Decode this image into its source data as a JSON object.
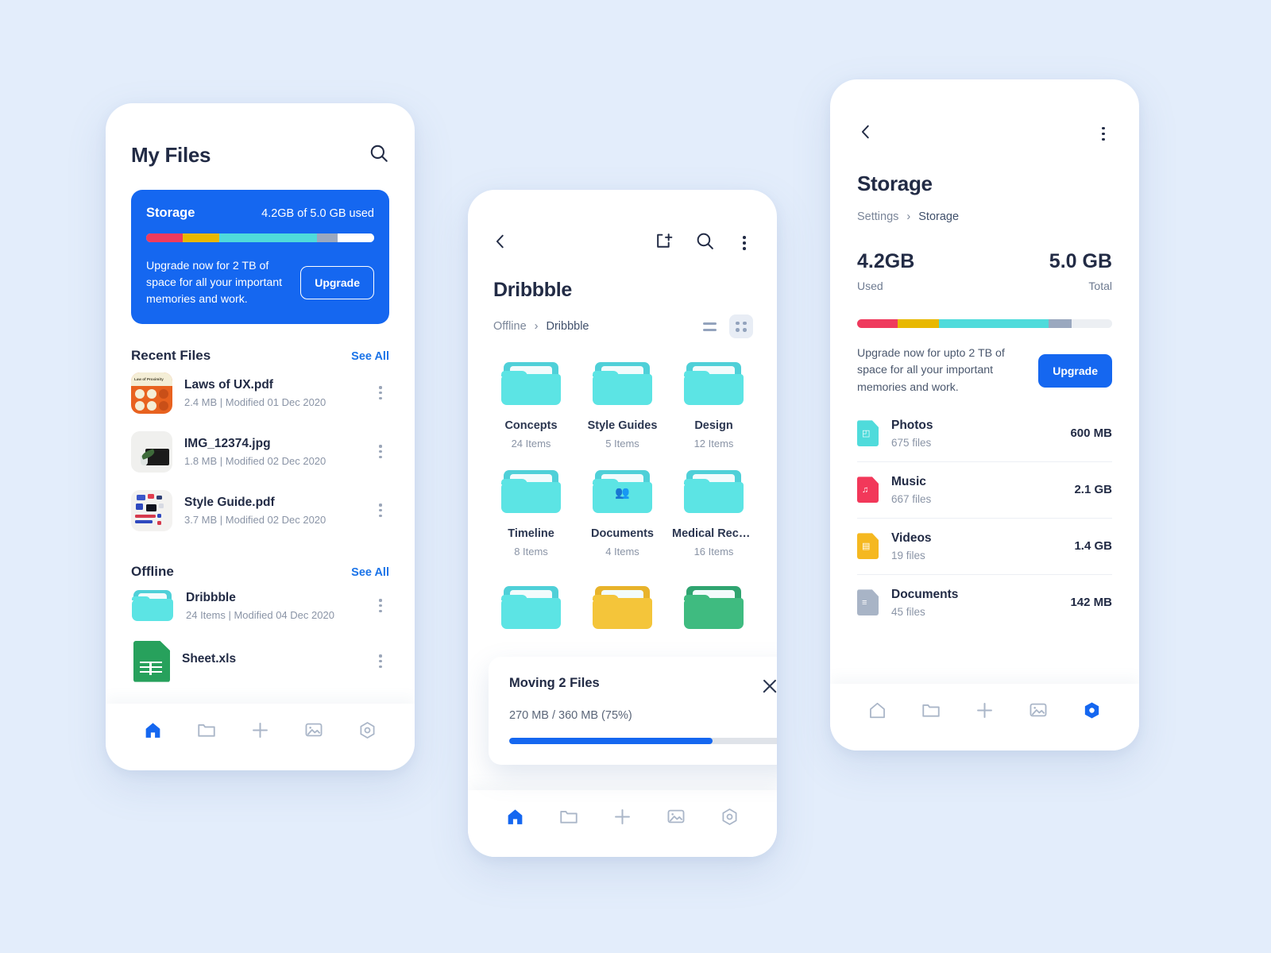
{
  "colors": {
    "background": "#e3edfb",
    "primary_blue": "#1567f0",
    "accent_teal": "#5ce4e4",
    "bar_red": "#ef3a5d",
    "bar_yellow": "#e8b800",
    "bar_cyan": "#4fdbdb",
    "bar_slate": "#9aa8bf",
    "text_dark": "#222b45",
    "text_mute": "#8a94a6"
  },
  "phone1": {
    "title": "My Files",
    "search_icon": "search-icon",
    "storage_card": {
      "label": "Storage",
      "usage": "4.2GB of 5.0 GB used",
      "promo": "Upgrade now for 2 TB of space for all your important memories and work.",
      "button": "Upgrade",
      "segments": [
        {
          "name": "photos",
          "color": "#ef3a5d",
          "percent": 16
        },
        {
          "name": "music",
          "color": "#e8b800",
          "percent": 16
        },
        {
          "name": "videos",
          "color": "#4fdbdb",
          "percent": 43
        },
        {
          "name": "documents",
          "color": "#9aa8bf",
          "percent": 9
        },
        {
          "name": "free",
          "color": "#ffffff",
          "percent": 16
        }
      ]
    },
    "recent": {
      "title": "Recent Files",
      "see_all": "See All",
      "items": [
        {
          "name": "Laws of UX.pdf",
          "meta": "2.4 MB  |  Modified 01 Dec 2020",
          "thumb": "pdf-laws-of-ux-thumbnail",
          "caption": "Law of Proximity"
        },
        {
          "name": "IMG_12374.jpg",
          "meta": "1.8 MB  |  Modified 02 Dec 2020",
          "thumb": "photo-desk-thumbnail"
        },
        {
          "name": "Style Guide.pdf",
          "meta": "3.7 MB  |  Modified 02 Dec 2020",
          "thumb": "pdf-style-guide-thumbnail"
        }
      ]
    },
    "offline": {
      "title": "Offline",
      "see_all": "See All",
      "items": [
        {
          "name": "Dribbble",
          "meta": "24 Items  |  Modified 04 Dec 2020",
          "thumb": "folder-icon"
        },
        {
          "name": "Sheet.xls",
          "meta": "",
          "thumb": "xls-file-icon"
        }
      ]
    },
    "nav": [
      {
        "name": "home-icon",
        "active": true
      },
      {
        "name": "folder-icon",
        "active": false
      },
      {
        "name": "plus-icon",
        "active": false
      },
      {
        "name": "image-icon",
        "active": false
      },
      {
        "name": "settings-icon",
        "active": false
      }
    ]
  },
  "phone2": {
    "back_icon": "chevron-left-icon",
    "actions": [
      "new-folder-icon",
      "search-icon",
      "more-vertical-icon"
    ],
    "title": "Dribbble",
    "breadcrumb": {
      "parent": "Offline",
      "separator": "›",
      "current": "Dribbble"
    },
    "view_list_icon": "list-view-icon",
    "view_grid_icon": "grid-view-icon",
    "folders": [
      {
        "name": "Concepts",
        "count": "24 Items",
        "color": "teal",
        "shared": false
      },
      {
        "name": "Style Guides",
        "count": "5 Items",
        "color": "teal",
        "shared": false
      },
      {
        "name": "Design",
        "count": "12 Items",
        "color": "teal",
        "shared": false
      },
      {
        "name": "Timeline",
        "count": "8 Items",
        "color": "teal",
        "shared": false
      },
      {
        "name": "Documents",
        "count": "4 Items",
        "color": "teal",
        "shared": true
      },
      {
        "name": "Medical Recor...",
        "count": "16 Items",
        "color": "teal",
        "shared": false
      }
    ],
    "partial_row": [
      {
        "color": "teal"
      },
      {
        "color": "yellow"
      },
      {
        "color": "green"
      }
    ],
    "modal": {
      "title": "Moving 2 Files",
      "progress_text": "270 MB / 360 MB (75%)",
      "progress_percent": 75,
      "close_icon": "close-icon"
    },
    "nav": [
      {
        "name": "home-icon",
        "active": true
      },
      {
        "name": "folder-icon",
        "active": false
      },
      {
        "name": "plus-icon",
        "active": false
      },
      {
        "name": "image-icon",
        "active": false
      },
      {
        "name": "settings-icon",
        "active": false
      }
    ]
  },
  "phone3": {
    "back_icon": "chevron-left-icon",
    "more_icon": "more-vertical-icon",
    "title": "Storage",
    "breadcrumb": {
      "parent": "Settings",
      "separator": "›",
      "current": "Storage"
    },
    "used_value": "4.2GB",
    "used_label": "Used",
    "total_value": "5.0 GB",
    "total_label": "Total",
    "segments": [
      {
        "name": "photos",
        "color": "#ef3a5d",
        "percent": 16
      },
      {
        "name": "music",
        "color": "#e8b800",
        "percent": 16
      },
      {
        "name": "videos",
        "color": "#4fdbdb",
        "percent": 43
      },
      {
        "name": "documents",
        "color": "#9aa8bf",
        "percent": 9
      },
      {
        "name": "free",
        "color": "#eceff3",
        "percent": 16
      }
    ],
    "promo": "Upgrade now for upto 2 TB of space for all your important memories and work.",
    "promo_button": "Upgrade",
    "categories": [
      {
        "name": "Photos",
        "files": "675 files",
        "size": "600 MB",
        "icon": "photos-file-icon",
        "color": "#4fdbdb",
        "glyph": "◰"
      },
      {
        "name": "Music",
        "files": "667 files",
        "size": "2.1 GB",
        "icon": "music-file-icon",
        "color": "#f2385a",
        "glyph": "♫"
      },
      {
        "name": "Videos",
        "files": "19 files",
        "size": "1.4 GB",
        "icon": "videos-file-icon",
        "color": "#f5b820",
        "glyph": "▤"
      },
      {
        "name": "Documents",
        "files": "45 files",
        "size": "142 MB",
        "icon": "documents-file-icon",
        "color": "#a8b4c6",
        "glyph": "≡"
      }
    ],
    "nav": [
      {
        "name": "home-icon",
        "active": false
      },
      {
        "name": "folder-icon",
        "active": false
      },
      {
        "name": "plus-icon",
        "active": false
      },
      {
        "name": "image-icon",
        "active": false
      },
      {
        "name": "settings-icon",
        "active": true
      }
    ]
  }
}
